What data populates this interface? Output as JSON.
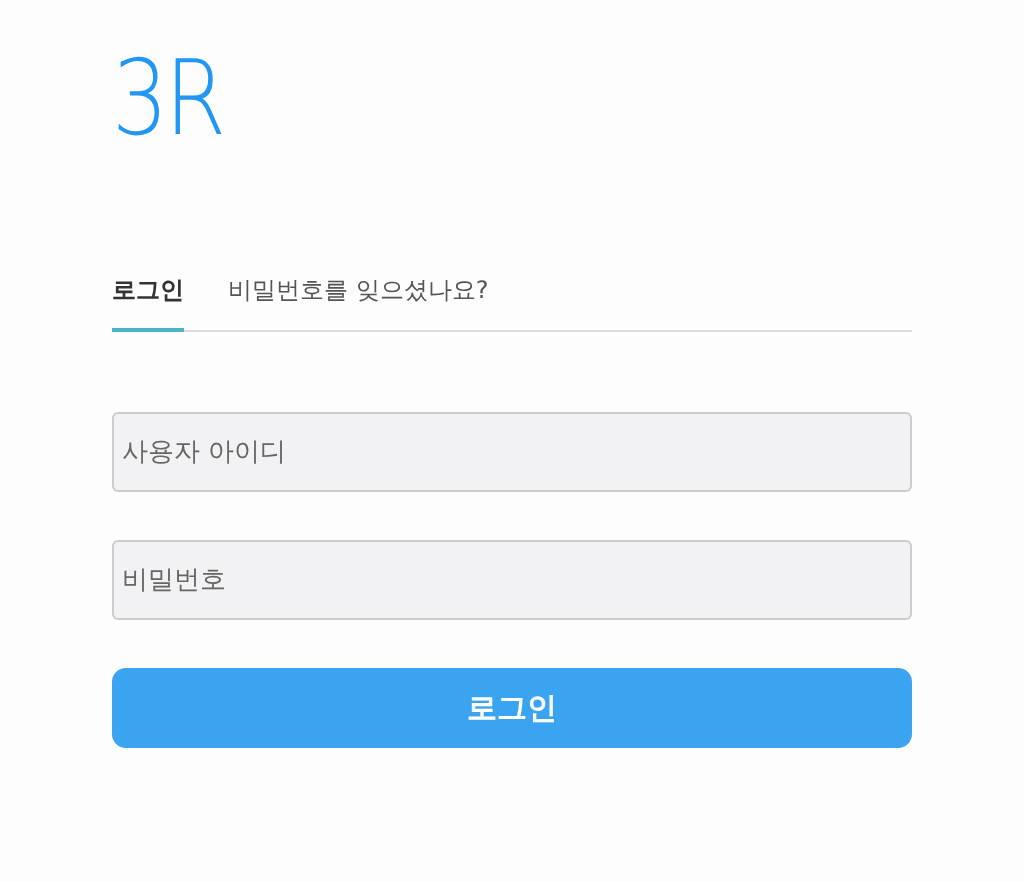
{
  "logo": "3R",
  "tabs": [
    {
      "label": "로그인",
      "selected": true
    },
    {
      "label": "비밀번호를 잊으셨나요?",
      "selected": false
    }
  ],
  "fields": [
    {
      "placeholder": "사용자 아이디"
    },
    {
      "placeholder": "비밀번호"
    }
  ],
  "submit": "로그인"
}
